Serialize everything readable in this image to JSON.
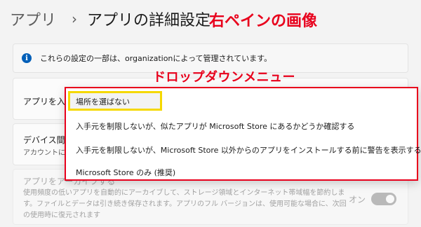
{
  "header": {
    "parent": "アプリ",
    "separator": "›",
    "current": "アプリの詳細設定",
    "annotation": "右ペインの画像"
  },
  "info_bar": {
    "icon": "info-icon",
    "text": "これらの設定の一部は、organizationによって管理されています。"
  },
  "dropdown_annotation": "ドロップダウンメニュー",
  "cards": {
    "source_title": "アプリを入手",
    "device_title": "デバイス間の",
    "device_sub": "アカウントに接",
    "archive_title": "アプリをアーカイブする",
    "archive_sub": "使用頻度の低いアプリを自動的にアーカイブして、ストレージ領域とインターネット帯域幅を節約します。ファイルとデータは引き続き保存されます。アプリのフル バージョンは、使用可能な場合に、次回の使用時に復元されます",
    "archive_toggle_label": "オン"
  },
  "dropdown": {
    "items": [
      "場所を選ばない",
      "入手元を制限しないが、似たアプリが Microsoft Store にあるかどうか確認する",
      "入手元を制限しないが、Microsoft Store 以外からのアプリをインストールする前に警告を表示する",
      "Microsoft Store のみ (推奨)"
    ],
    "selected_index": 0
  },
  "colors": {
    "annotation_red": "#e8001c",
    "highlight_yellow": "#f5d800",
    "accent_blue": "#005fb8"
  }
}
